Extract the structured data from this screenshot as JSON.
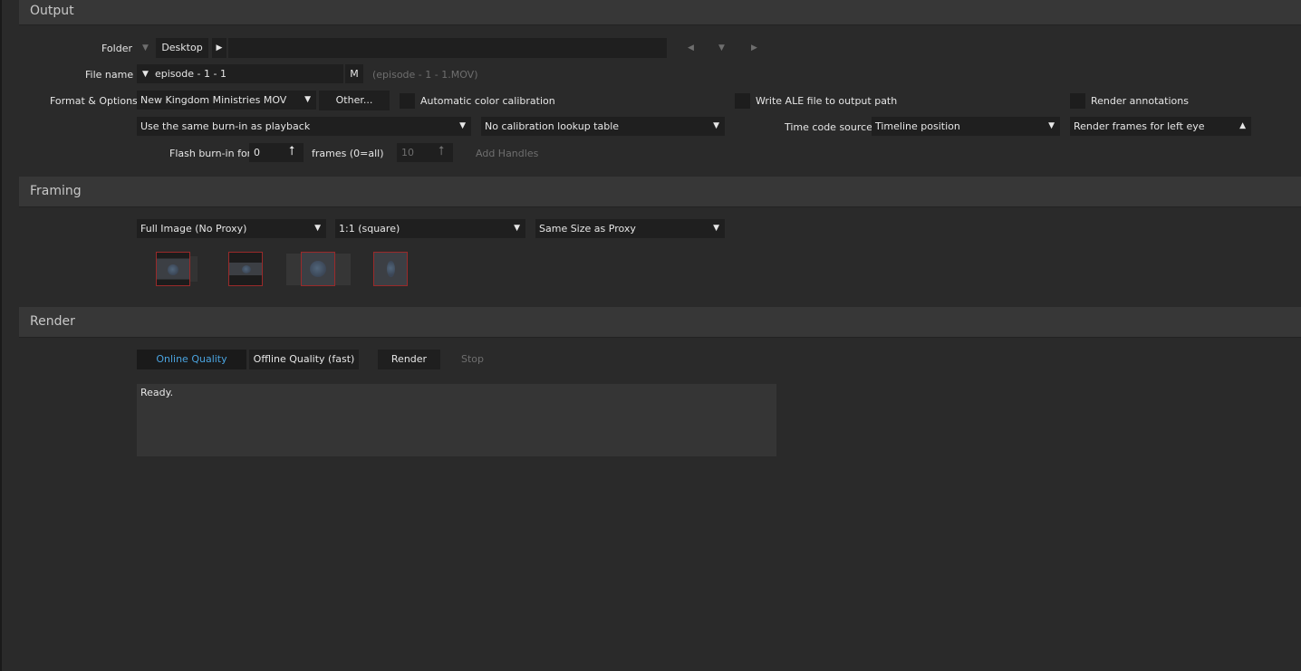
{
  "output": {
    "title": "Output",
    "folder_label": "Folder",
    "folder_dropdown_arrow": "▼",
    "folder_value": "Desktop",
    "folder_path_arrow": "▶",
    "folder_path": "",
    "nav_back": "◀",
    "nav_down": "▼",
    "nav_forward": "▶",
    "filename_label": "File name",
    "filename_value": "episode - 1 - 1",
    "filename_m_button": "M",
    "filename_preview": "(episode - 1 - 1.MOV)",
    "format_label": "Format & Options",
    "format_value": "New Kingdom Ministries MOV",
    "other_button": "Other...",
    "auto_color_label": "Automatic color calibration",
    "write_ale_label": "Write ALE file to output path",
    "render_annotations_label": "Render annotations",
    "burnin_value": "Use the same burn-in as playback",
    "calibration_value": "No calibration lookup table",
    "timecode_label": "Time code source",
    "timecode_value": "Timeline position",
    "eye_value": "Render frames for left eye",
    "flash_label": "Flash burn-in for",
    "flash_frames": "0",
    "frames_label": "frames (0=all)",
    "handles_value": "10",
    "add_handles_label": "Add Handles"
  },
  "framing": {
    "title": "Framing",
    "proxy_value": "Full Image (No Proxy)",
    "aspect_value": "1:1 (square)",
    "size_value": "Same Size as Proxy",
    "thumbnail_icons": [
      "letterbox-fit-icon",
      "letterbox-fill-icon",
      "center-crop-icon",
      "vertical-fit-icon"
    ]
  },
  "render": {
    "title": "Render",
    "online_quality": "Online Quality",
    "offline_quality": "Offline Quality (fast)",
    "render_button": "Render",
    "stop_button": "Stop",
    "log_text": "Ready."
  },
  "colors": {
    "accent_blue": "#4aa3df",
    "background": "#2a2a2a",
    "header": "#373737",
    "field": "#1f1f1f"
  }
}
